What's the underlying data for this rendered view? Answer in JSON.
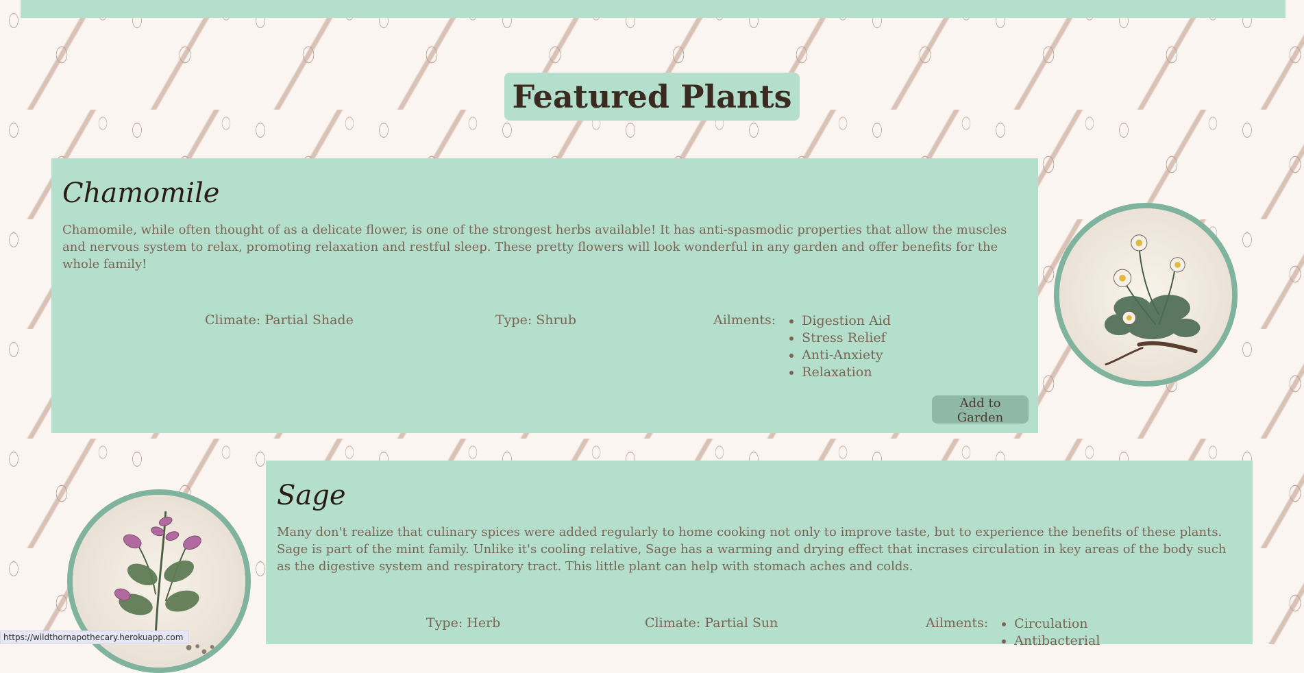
{
  "page": {
    "title": "Featured Plants"
  },
  "plants": [
    {
      "name": "Chamomile",
      "description": "Chamomile, while often thought of as a delicate flower, is one of the strongest herbs available! It has anti-spasmodic properties that allow the muscles and nervous system to relax, promoting relaxation and restful sleep. These pretty flowers will look wonderful in any garden and offer benefits for the whole family!",
      "climate": "Climate: Partial Shade",
      "type": "Type: Shrub",
      "ailments_label": "Ailments:",
      "ailments": [
        "Digestion Aid",
        "Stress Relief",
        "Anti-Anxiety",
        "Relaxation"
      ],
      "button_label": "Add to Garden"
    },
    {
      "name": "Sage",
      "description": "Many don't realize that culinary spices were added regularly to home cooking not only to improve taste, but to experience the benefits of these plants. Sage is part of the mint family. Unlike it's cooling relative, Sage has a warming and drying effect that incrases circulation in key areas of the body such as the digestive system and respiratory tract. This little plant can help with stomach aches and colds.",
      "type": "Type: Herb",
      "climate": "Climate: Partial Sun",
      "ailments_label": "Ailments:",
      "ailments": [
        "Circulation",
        "Antibacterial"
      ]
    }
  ],
  "status": {
    "url": "https://wildthornapothecary.herokuapp.com"
  },
  "colors": {
    "background": "#fbf5f1",
    "card": "#b5dfcd",
    "button": "#8fb9a6",
    "photo_ring": "#7fb39e",
    "pattern": "#b58c78"
  }
}
